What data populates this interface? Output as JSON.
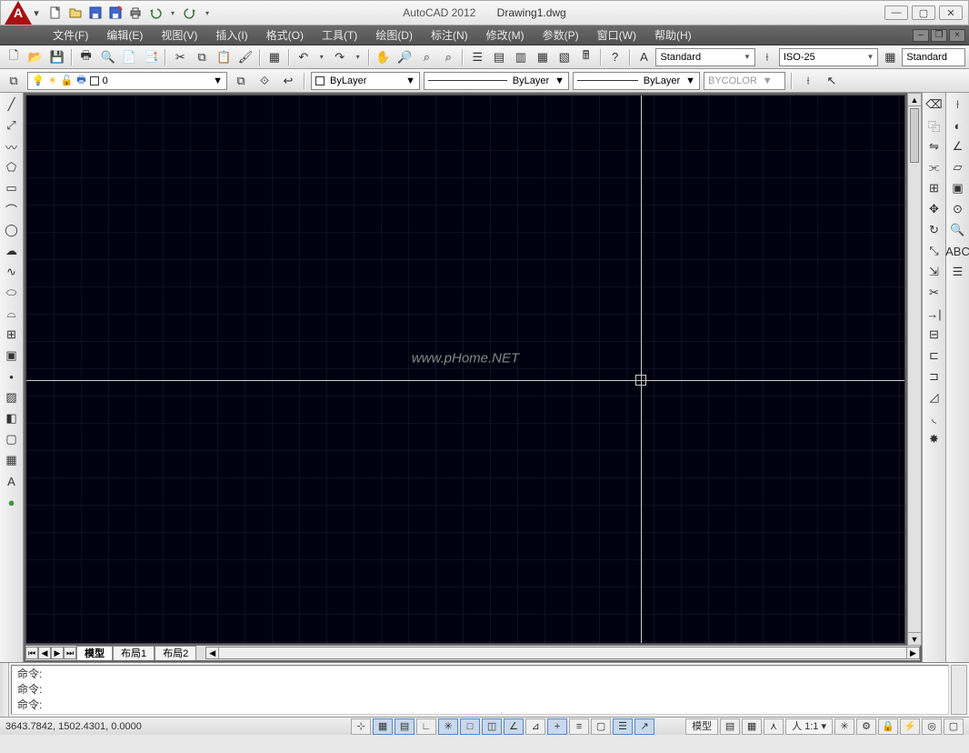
{
  "title": {
    "app": "AutoCAD 2012",
    "file": "Drawing1.dwg"
  },
  "menu": [
    "文件(F)",
    "编辑(E)",
    "视图(V)",
    "插入(I)",
    "格式(O)",
    "工具(T)",
    "绘图(D)",
    "标注(N)",
    "修改(M)",
    "参数(P)",
    "窗口(W)",
    "帮助(H)"
  ],
  "styles": {
    "text_style": "Standard",
    "dim_style": "ISO-25",
    "table_style": "Standard"
  },
  "layer": {
    "current": "0",
    "linetype": "ByLayer",
    "lineweight": "ByLayer",
    "plotstyle": "ByLayer",
    "color": "BYCOLOR"
  },
  "tabs": {
    "active": "模型",
    "layouts": [
      "布局1",
      "布局2"
    ]
  },
  "watermark": "www.pHome.NET",
  "command": {
    "history": [
      "命令:",
      "命令:"
    ],
    "prompt": "命令:"
  },
  "status": {
    "coords": "3643.7842, 1502.4301, 0.0000",
    "space": "模型",
    "scale_label": "人",
    "scale": "1:1"
  },
  "qat_icons": [
    "new",
    "open",
    "save",
    "saveas",
    "print",
    "undo",
    "redo"
  ],
  "left_tools": [
    "line",
    "construction-line",
    "polyline",
    "polygon",
    "rectangle",
    "arc",
    "circle",
    "spline",
    "revision-cloud",
    "ellipse",
    "ellipse-arc",
    "insert-block",
    "make-block",
    "hatch",
    "gradient",
    "table",
    "text",
    "point"
  ],
  "right_tools": [
    "erase",
    "copy",
    "mirror",
    "offset",
    "array",
    "move",
    "rotate",
    "scale",
    "stretch",
    "trim",
    "extend",
    "break",
    "fillet",
    "chamfer",
    "explode"
  ],
  "right_tools2": [
    "distance",
    "area",
    "region",
    "list",
    "id",
    "dimension",
    "leader",
    "text-style",
    "units"
  ]
}
